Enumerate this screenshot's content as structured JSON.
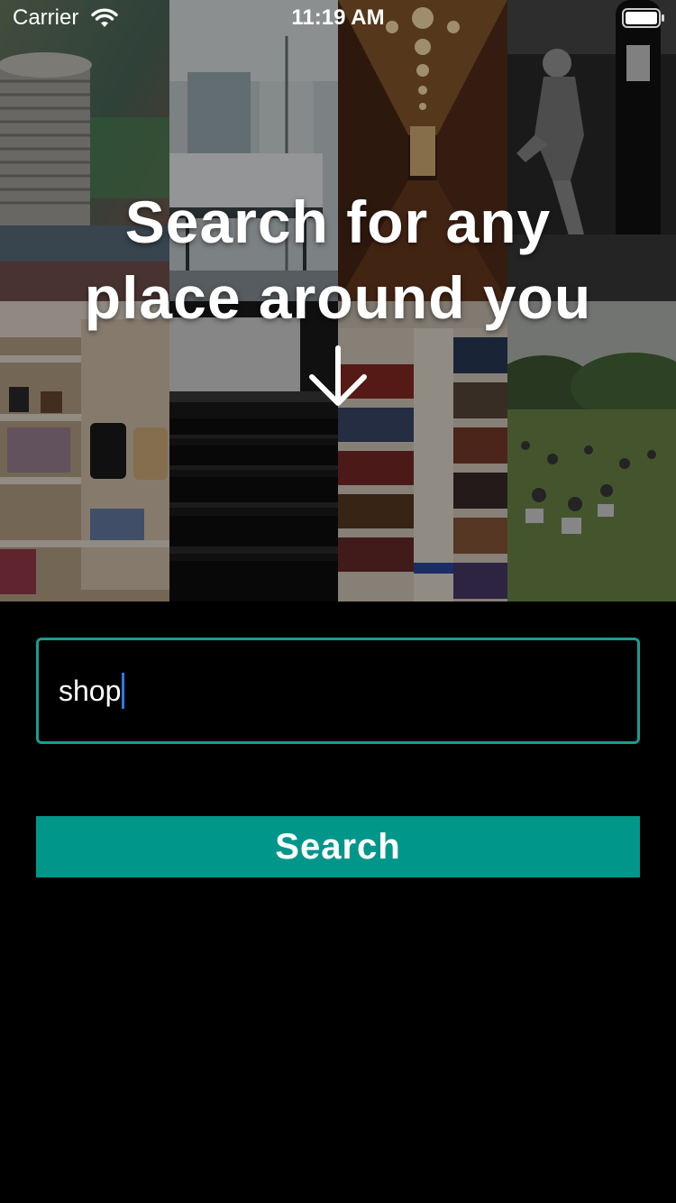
{
  "status_bar": {
    "carrier": "Carrier",
    "time": "11:19 AM",
    "icons": [
      "wifi-icon",
      "battery-icon"
    ]
  },
  "hero": {
    "headline_line1": "Search for any",
    "headline_line2": "place around you",
    "arrow_icon": "arrow-down-icon",
    "tiles": [
      "coins",
      "hospital-room",
      "hotel-corridor",
      "boxing-gym",
      "fashion-store",
      "movie-theater",
      "library",
      "park"
    ]
  },
  "search": {
    "value": "shop",
    "button_label": "Search"
  },
  "colors": {
    "accent": "#00978a",
    "field_border": "#1b9c8e",
    "background": "#000000",
    "caret": "#2d7be5"
  }
}
